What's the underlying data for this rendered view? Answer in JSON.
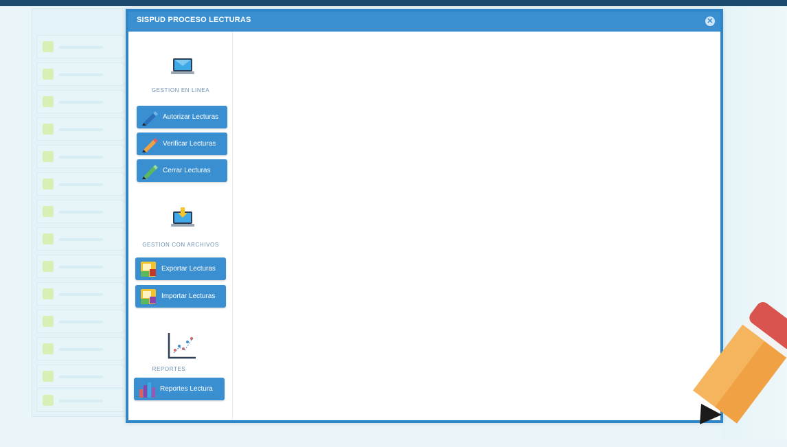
{
  "modal": {
    "title": "SISPUD PROCESO LECTURAS",
    "close_icon": "close-icon"
  },
  "sections": [
    {
      "label": "GESTION EN LINEA",
      "icon": "monitor-icon",
      "buttons": [
        {
          "label": "Autorizar Lecturas",
          "icon": "blue-pencil-icon"
        },
        {
          "label": "Verificar Lecturas",
          "icon": "orange-pencil-icon"
        },
        {
          "label": "Cerrar Lecturas",
          "icon": "green-pencil-icon"
        }
      ]
    },
    {
      "label": "GESTION CON ARCHIVOS",
      "icon": "download-monitor-icon",
      "buttons": [
        {
          "label": "Exportar Lecturas",
          "icon": "export-file-icon"
        },
        {
          "label": "Importar Lecturas",
          "icon": "import-file-icon"
        }
      ]
    },
    {
      "label": "REPORTES",
      "icon": "scatter-chart-icon",
      "buttons": [
        {
          "label": "Reportes Lectura",
          "icon": "bar-chart-icon"
        }
      ]
    }
  ],
  "colors": {
    "header": "#3a8fd0",
    "button": "#3a8fd0",
    "topbar": "#1c4a6e"
  }
}
